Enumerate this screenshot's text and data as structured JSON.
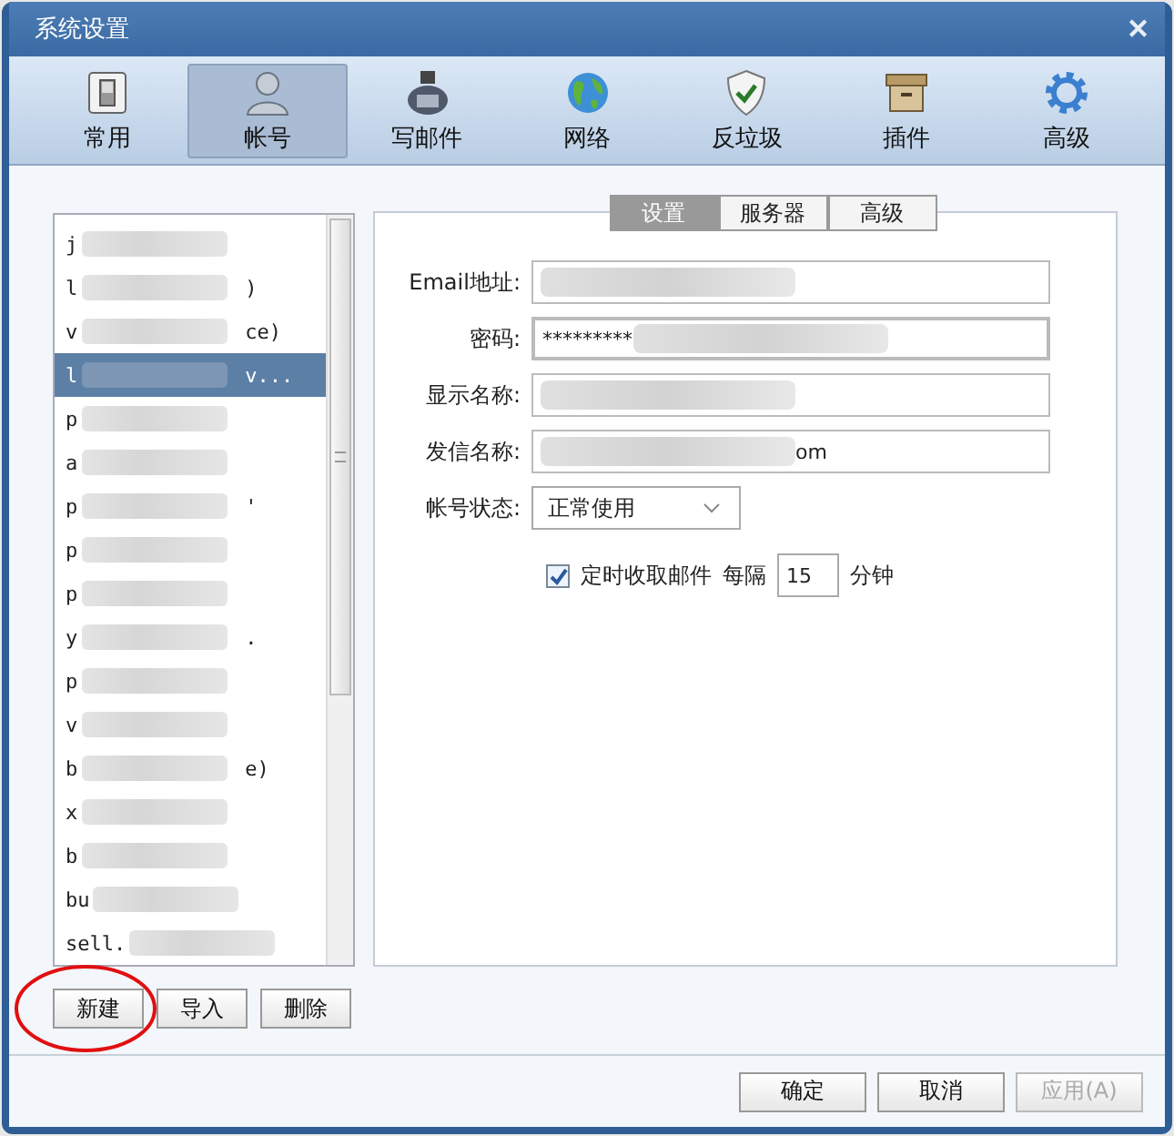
{
  "window": {
    "title": "系统设置",
    "close": "✕"
  },
  "toolbar": [
    {
      "label": "常用",
      "selected": false
    },
    {
      "label": "帐号",
      "selected": true
    },
    {
      "label": "写邮件",
      "selected": false
    },
    {
      "label": "网络",
      "selected": false
    },
    {
      "label": "反垃圾",
      "selected": false
    },
    {
      "label": "插件",
      "selected": false
    },
    {
      "label": "高级",
      "selected": false
    }
  ],
  "accounts": [
    {
      "head": "j",
      "selected": false
    },
    {
      "head": "l",
      "tail": ")",
      "selected": false
    },
    {
      "head": "v",
      "tail": "ce)",
      "selected": false
    },
    {
      "head": "l",
      "tail": "v...",
      "selected": true
    },
    {
      "head": "p",
      "selected": false
    },
    {
      "head": "a",
      "selected": false
    },
    {
      "head": "p",
      "tail": "'",
      "selected": false
    },
    {
      "head": "p",
      "selected": false
    },
    {
      "head": "p",
      "selected": false
    },
    {
      "head": "y",
      "tail": ".",
      "selected": false
    },
    {
      "head": "p",
      "selected": false
    },
    {
      "head": "v",
      "selected": false
    },
    {
      "head": "b",
      "tail": "e)",
      "selected": false
    },
    {
      "head": "x",
      "selected": false
    },
    {
      "head": "b",
      "selected": false
    },
    {
      "head": "bu",
      "selected": false
    },
    {
      "head": "sell.",
      "selected": false
    }
  ],
  "list_buttons": [
    "新建",
    "导入",
    "删除"
  ],
  "tabs": [
    {
      "label": "设置",
      "selected": true
    },
    {
      "label": "服务器",
      "selected": false
    },
    {
      "label": "高级",
      "selected": false
    }
  ],
  "form": [
    {
      "label": "Email地址:"
    },
    {
      "label": "密码:",
      "value": "*********"
    },
    {
      "label": "显示名称:"
    },
    {
      "label": "发信名称:",
      "value": "om"
    }
  ],
  "status": {
    "label": "帐号状态:",
    "value": "正常使用"
  },
  "auto_fetch": {
    "checked": true,
    "label": "定时收取邮件",
    "every": "每隔",
    "minutes": "15",
    "unit": "分钟"
  },
  "footer_buttons": [
    {
      "label": "确定",
      "disabled": false
    },
    {
      "label": "取消",
      "disabled": false
    },
    {
      "label": "应用(A)",
      "disabled": true
    }
  ]
}
